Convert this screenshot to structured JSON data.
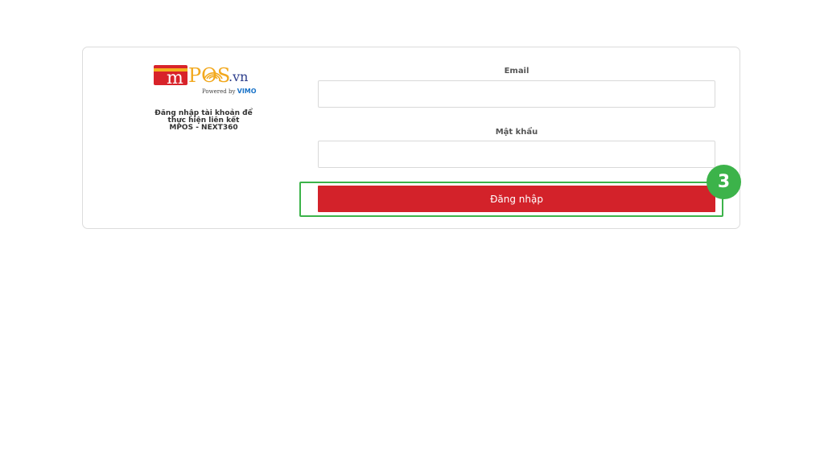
{
  "logo": {
    "m": "m",
    "pos": "POS",
    "tld": ".vn",
    "powered_prefix": "Powered by",
    "powered_brand": "VIMO"
  },
  "intro": {
    "line1": "Đăng nhập tài khoản để",
    "line2": "thực hiện liên kết",
    "line3": "MPOS - NEXT360"
  },
  "form": {
    "email_label": "Email",
    "email_value": "",
    "password_label": "Mật khẩu",
    "password_value": "",
    "submit_label": "Đăng nhập"
  },
  "annotation": {
    "step_number": "3"
  },
  "colors": {
    "brand_red": "#d3222a",
    "brand_orange": "#f2a81d",
    "highlight_green": "#3cb34a"
  }
}
